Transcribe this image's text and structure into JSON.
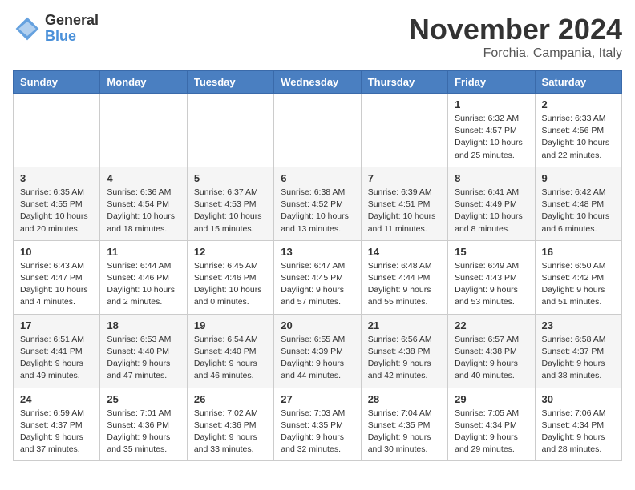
{
  "logo": {
    "general": "General",
    "blue": "Blue"
  },
  "header": {
    "month": "November 2024",
    "location": "Forchia, Campania, Italy"
  },
  "weekdays": [
    "Sunday",
    "Monday",
    "Tuesday",
    "Wednesday",
    "Thursday",
    "Friday",
    "Saturday"
  ],
  "weeks": [
    [
      {
        "day": "",
        "info": ""
      },
      {
        "day": "",
        "info": ""
      },
      {
        "day": "",
        "info": ""
      },
      {
        "day": "",
        "info": ""
      },
      {
        "day": "",
        "info": ""
      },
      {
        "day": "1",
        "info": "Sunrise: 6:32 AM\nSunset: 4:57 PM\nDaylight: 10 hours\nand 25 minutes."
      },
      {
        "day": "2",
        "info": "Sunrise: 6:33 AM\nSunset: 4:56 PM\nDaylight: 10 hours\nand 22 minutes."
      }
    ],
    [
      {
        "day": "3",
        "info": "Sunrise: 6:35 AM\nSunset: 4:55 PM\nDaylight: 10 hours\nand 20 minutes."
      },
      {
        "day": "4",
        "info": "Sunrise: 6:36 AM\nSunset: 4:54 PM\nDaylight: 10 hours\nand 18 minutes."
      },
      {
        "day": "5",
        "info": "Sunrise: 6:37 AM\nSunset: 4:53 PM\nDaylight: 10 hours\nand 15 minutes."
      },
      {
        "day": "6",
        "info": "Sunrise: 6:38 AM\nSunset: 4:52 PM\nDaylight: 10 hours\nand 13 minutes."
      },
      {
        "day": "7",
        "info": "Sunrise: 6:39 AM\nSunset: 4:51 PM\nDaylight: 10 hours\nand 11 minutes."
      },
      {
        "day": "8",
        "info": "Sunrise: 6:41 AM\nSunset: 4:49 PM\nDaylight: 10 hours\nand 8 minutes."
      },
      {
        "day": "9",
        "info": "Sunrise: 6:42 AM\nSunset: 4:48 PM\nDaylight: 10 hours\nand 6 minutes."
      }
    ],
    [
      {
        "day": "10",
        "info": "Sunrise: 6:43 AM\nSunset: 4:47 PM\nDaylight: 10 hours\nand 4 minutes."
      },
      {
        "day": "11",
        "info": "Sunrise: 6:44 AM\nSunset: 4:46 PM\nDaylight: 10 hours\nand 2 minutes."
      },
      {
        "day": "12",
        "info": "Sunrise: 6:45 AM\nSunset: 4:46 PM\nDaylight: 10 hours\nand 0 minutes."
      },
      {
        "day": "13",
        "info": "Sunrise: 6:47 AM\nSunset: 4:45 PM\nDaylight: 9 hours\nand 57 minutes."
      },
      {
        "day": "14",
        "info": "Sunrise: 6:48 AM\nSunset: 4:44 PM\nDaylight: 9 hours\nand 55 minutes."
      },
      {
        "day": "15",
        "info": "Sunrise: 6:49 AM\nSunset: 4:43 PM\nDaylight: 9 hours\nand 53 minutes."
      },
      {
        "day": "16",
        "info": "Sunrise: 6:50 AM\nSunset: 4:42 PM\nDaylight: 9 hours\nand 51 minutes."
      }
    ],
    [
      {
        "day": "17",
        "info": "Sunrise: 6:51 AM\nSunset: 4:41 PM\nDaylight: 9 hours\nand 49 minutes."
      },
      {
        "day": "18",
        "info": "Sunrise: 6:53 AM\nSunset: 4:40 PM\nDaylight: 9 hours\nand 47 minutes."
      },
      {
        "day": "19",
        "info": "Sunrise: 6:54 AM\nSunset: 4:40 PM\nDaylight: 9 hours\nand 46 minutes."
      },
      {
        "day": "20",
        "info": "Sunrise: 6:55 AM\nSunset: 4:39 PM\nDaylight: 9 hours\nand 44 minutes."
      },
      {
        "day": "21",
        "info": "Sunrise: 6:56 AM\nSunset: 4:38 PM\nDaylight: 9 hours\nand 42 minutes."
      },
      {
        "day": "22",
        "info": "Sunrise: 6:57 AM\nSunset: 4:38 PM\nDaylight: 9 hours\nand 40 minutes."
      },
      {
        "day": "23",
        "info": "Sunrise: 6:58 AM\nSunset: 4:37 PM\nDaylight: 9 hours\nand 38 minutes."
      }
    ],
    [
      {
        "day": "24",
        "info": "Sunrise: 6:59 AM\nSunset: 4:37 PM\nDaylight: 9 hours\nand 37 minutes."
      },
      {
        "day": "25",
        "info": "Sunrise: 7:01 AM\nSunset: 4:36 PM\nDaylight: 9 hours\nand 35 minutes."
      },
      {
        "day": "26",
        "info": "Sunrise: 7:02 AM\nSunset: 4:36 PM\nDaylight: 9 hours\nand 33 minutes."
      },
      {
        "day": "27",
        "info": "Sunrise: 7:03 AM\nSunset: 4:35 PM\nDaylight: 9 hours\nand 32 minutes."
      },
      {
        "day": "28",
        "info": "Sunrise: 7:04 AM\nSunset: 4:35 PM\nDaylight: 9 hours\nand 30 minutes."
      },
      {
        "day": "29",
        "info": "Sunrise: 7:05 AM\nSunset: 4:34 PM\nDaylight: 9 hours\nand 29 minutes."
      },
      {
        "day": "30",
        "info": "Sunrise: 7:06 AM\nSunset: 4:34 PM\nDaylight: 9 hours\nand 28 minutes."
      }
    ]
  ]
}
